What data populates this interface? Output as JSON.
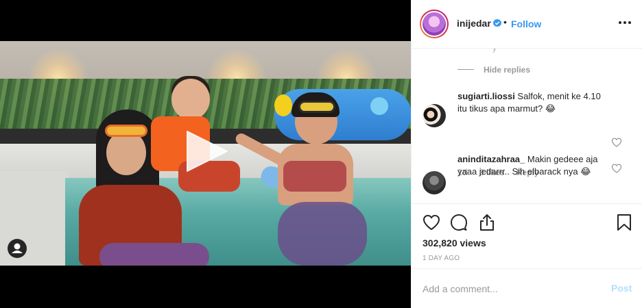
{
  "post": {
    "username": "inijedar",
    "verified_icon": "verified-badge-icon",
    "separator": "•",
    "follow_label": "Follow",
    "more_icon": "more-options-icon"
  },
  "media": {
    "play_icon": "play-icon",
    "account_icon": "account-icon"
  },
  "comments": {
    "partial_reply_text": "y",
    "hide_replies_label": "Hide replies",
    "items": [
      {
        "username": "sugiarti.liossi",
        "text": " Salfok, menit ke 4.10 itu tikus apa marmut? 😂",
        "time": "1d",
        "likes": "3 likes",
        "reply_label": "Reply"
      },
      {
        "username": "aninditazahraa_",
        "text": " Makin gedeee aja yaaa jedarrr.. Sih elbarack nya 😂"
      }
    ]
  },
  "actions": {
    "like_icon": "heart-icon",
    "comment_icon": "comment-icon",
    "share_icon": "share-icon",
    "save_icon": "bookmark-icon",
    "views": "302,820 views",
    "timestamp": "1 DAY AGO"
  },
  "add_comment": {
    "placeholder": "Add a comment...",
    "post_label": "Post"
  },
  "colors": {
    "link_blue": "#3897f0",
    "post_disabled": "#b2dffc",
    "muted_text": "#999999",
    "border": "#efefef"
  }
}
